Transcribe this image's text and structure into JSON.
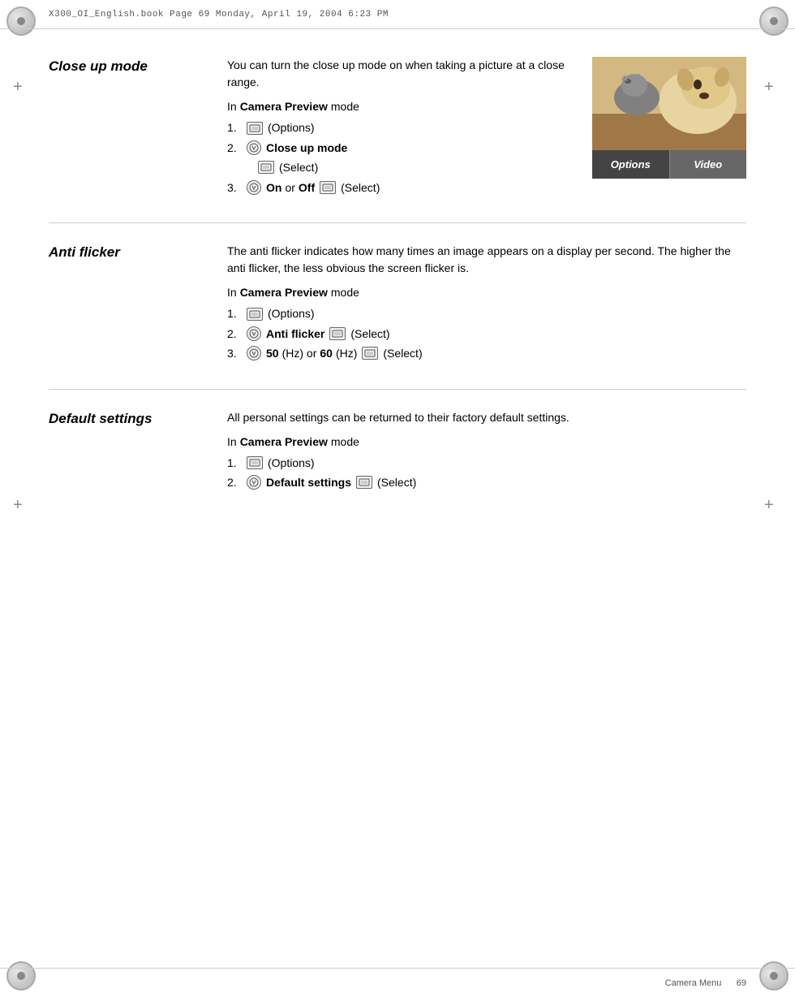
{
  "header": {
    "text": "X300_OI_English.book   Page 69   Monday, April 19, 2004   6:23 PM"
  },
  "footer": {
    "section_label": "Camera Menu",
    "page_number": "69"
  },
  "sections": {
    "close_up_mode": {
      "title": "Close up mode",
      "description": "You can turn the close up mode on when taking a picture at a close range.",
      "in_camera_preview_label": "In ",
      "camera_preview_bold": "Camera Preview",
      "camera_preview_suffix": " mode",
      "steps": [
        {
          "num": "1.",
          "icon_type": "btn",
          "label": "(Options)"
        },
        {
          "num": "2.",
          "icon_type": "nav",
          "bold_label": "Close up mode",
          "icon2_type": "btn",
          "label2": "(Select)"
        },
        {
          "num": "3.",
          "icon_type": "nav",
          "on_text": "On",
          "or_text": " or ",
          "off_text": "Off",
          "icon2_type": "btn",
          "label2": "(Select)"
        }
      ],
      "image": {
        "toolbar_options": "Options",
        "toolbar_video": "Video"
      }
    },
    "anti_flicker": {
      "title": "Anti flicker",
      "description": "The anti flicker indicates how many times an image appears on a display per second. The higher the anti flicker, the less obvious the screen flicker is.",
      "in_camera_preview_label": "In ",
      "camera_preview_bold": "Camera Preview",
      "camera_preview_suffix": " mode",
      "steps": [
        {
          "num": "1.",
          "icon_type": "btn",
          "label": "(Options)"
        },
        {
          "num": "2.",
          "icon_type": "nav",
          "bold_label": "Anti flicker",
          "icon2_type": "btn",
          "label2": "(Select)"
        },
        {
          "num": "3.",
          "icon_type": "nav",
          "hz50_bold": "50",
          "hz50_suffix": " (Hz) or ",
          "hz60_bold": "60",
          "hz60_suffix": " (Hz) ",
          "icon2_type": "btn",
          "label2": "(Select)"
        }
      ]
    },
    "default_settings": {
      "title": "Default settings",
      "description": "All personal settings can be returned to their factory default settings.",
      "in_camera_preview_label": "In ",
      "camera_preview_bold": "Camera Preview",
      "camera_preview_suffix": " mode",
      "steps": [
        {
          "num": "1.",
          "icon_type": "btn",
          "label": "(Options)"
        },
        {
          "num": "2.",
          "icon_type": "nav",
          "bold_label": "Default settings",
          "icon2_type": "btn",
          "label2": "(Select)"
        }
      ]
    }
  }
}
